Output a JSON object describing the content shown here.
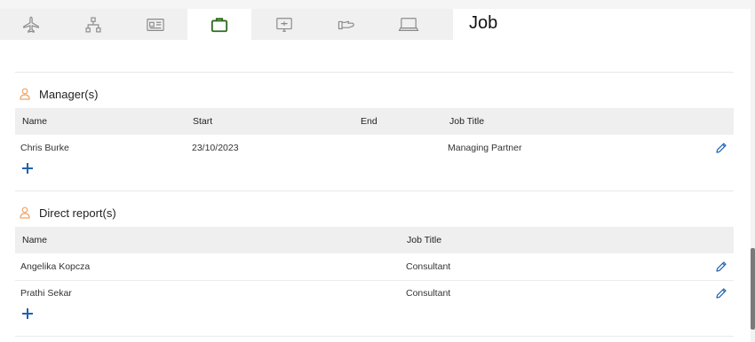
{
  "tabs": [
    {
      "icon": "airplane-icon",
      "active": false
    },
    {
      "icon": "org-chart-icon",
      "active": false
    },
    {
      "icon": "id-card-icon",
      "active": false
    },
    {
      "icon": "briefcase-icon",
      "active": true
    },
    {
      "icon": "monitor-icon",
      "active": false
    },
    {
      "icon": "hand-icon",
      "active": false
    },
    {
      "icon": "laptop-icon",
      "active": false
    }
  ],
  "page": {
    "title": "Job"
  },
  "colors": {
    "accent": "#1f62b0",
    "active_icon": "#2e6a1e",
    "person_icon": "#f0a465",
    "tab_icon": "#8a8a8a"
  },
  "managers": {
    "title": "Manager(s)",
    "columns": {
      "name": "Name",
      "start": "Start",
      "end": "End",
      "job_title": "Job Title"
    },
    "rows": [
      {
        "name": "Chris Burke",
        "start": "23/10/2023",
        "end": "",
        "job_title": "Managing Partner"
      }
    ]
  },
  "direct_reports": {
    "title": "Direct report(s)",
    "columns": {
      "name": "Name",
      "job_title": "Job Title"
    },
    "rows": [
      {
        "name": "Angelika Kopcza",
        "job_title": "Consultant"
      },
      {
        "name": "Prathi Sekar",
        "job_title": "Consultant"
      }
    ]
  }
}
